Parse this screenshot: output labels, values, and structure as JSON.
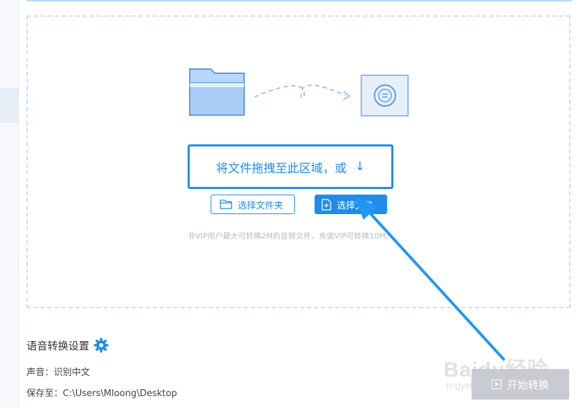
{
  "drop_zone": {
    "drag_text": "将文件拖拽至此区域，或",
    "select_folder_label": "选择文件夹",
    "select_file_label": "选择文件",
    "vip_note": "非VIP用户最大可转换2M的音频文件，充值VIP可转换10M。"
  },
  "settings": {
    "title": "语音转换设置",
    "sound_label": "声音：",
    "sound_value": "识别中文",
    "save_label": "保存至：",
    "save_path": "C:\\Users\\Mloong\\Desktop"
  },
  "start_button": {
    "label": "开始转换"
  },
  "watermark": {
    "logo": "Baidu经验",
    "url": "jingyan.baidu.com"
  },
  "colors": {
    "accent": "#1f8de8",
    "dashed_border": "#c9e0f4",
    "annotation": "#2196f3",
    "disabled_button": "#c8ccd2"
  },
  "icons": [
    "folder-icon",
    "convert-icon",
    "down-arrow-icon",
    "add-file-icon",
    "gear-icon",
    "play-icon"
  ]
}
